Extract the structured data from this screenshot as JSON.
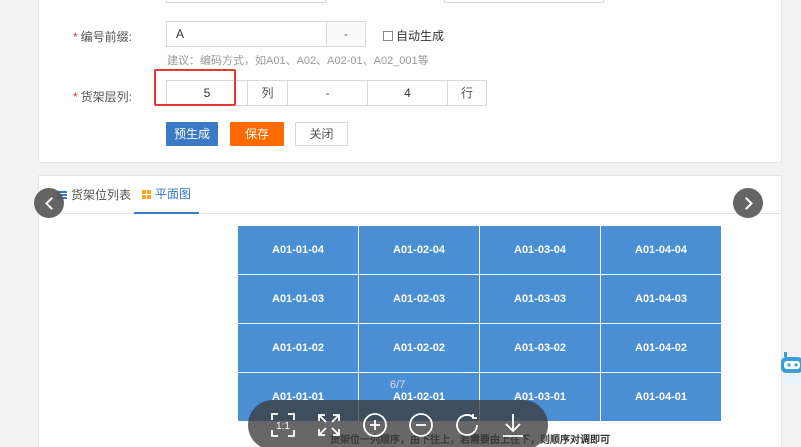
{
  "form": {
    "prefix": {
      "label": "编号前缀:",
      "required_mark": "*",
      "value": "A",
      "separator": "-",
      "auto_generate_label": "自动生成",
      "auto_generate_checked": false,
      "hint": "建议：编码方式，如A01、A02、A02-01、A02_001等"
    },
    "shelf": {
      "label": "货架层列:",
      "required_mark": "*",
      "columns_value": "5",
      "columns_unit": "列",
      "separator": "-",
      "rows_value": "4",
      "rows_unit": "行"
    },
    "buttons": {
      "pregenerate": "预生成",
      "save": "保存",
      "close": "关闭"
    }
  },
  "tabs": [
    {
      "label": "货架位列表",
      "icon": "list-icon",
      "active": false
    },
    {
      "label": "平面图",
      "icon": "grid-icon",
      "active": true
    }
  ],
  "grid": {
    "rows": [
      [
        "A01-01-04",
        "A01-02-04",
        "A01-03-04",
        "A01-04-04"
      ],
      [
        "A01-01-03",
        "A01-02-03",
        "A01-03-03",
        "A01-04-03"
      ],
      [
        "A01-01-02",
        "A01-02-02",
        "A01-03-02",
        "A01-04-02"
      ],
      [
        "A01-01-01",
        "A01-02-01",
        "A01-03-01",
        "A01-04-01"
      ]
    ],
    "cell_color": "#4a8fd4"
  },
  "viewer": {
    "page_counter": "6/7",
    "tools": [
      "actual-size-icon",
      "fullscreen-icon",
      "zoom-in-icon",
      "zoom-out-icon",
      "rotate-icon",
      "download-icon"
    ]
  },
  "caption": "货架位一列顺序，由下往上，若需要由上往下，则顺序对调即可",
  "colors": {
    "primary": "#3a7ac4",
    "save": "#ff6a00",
    "highlight": "#e53935",
    "required": "#e4393c"
  }
}
